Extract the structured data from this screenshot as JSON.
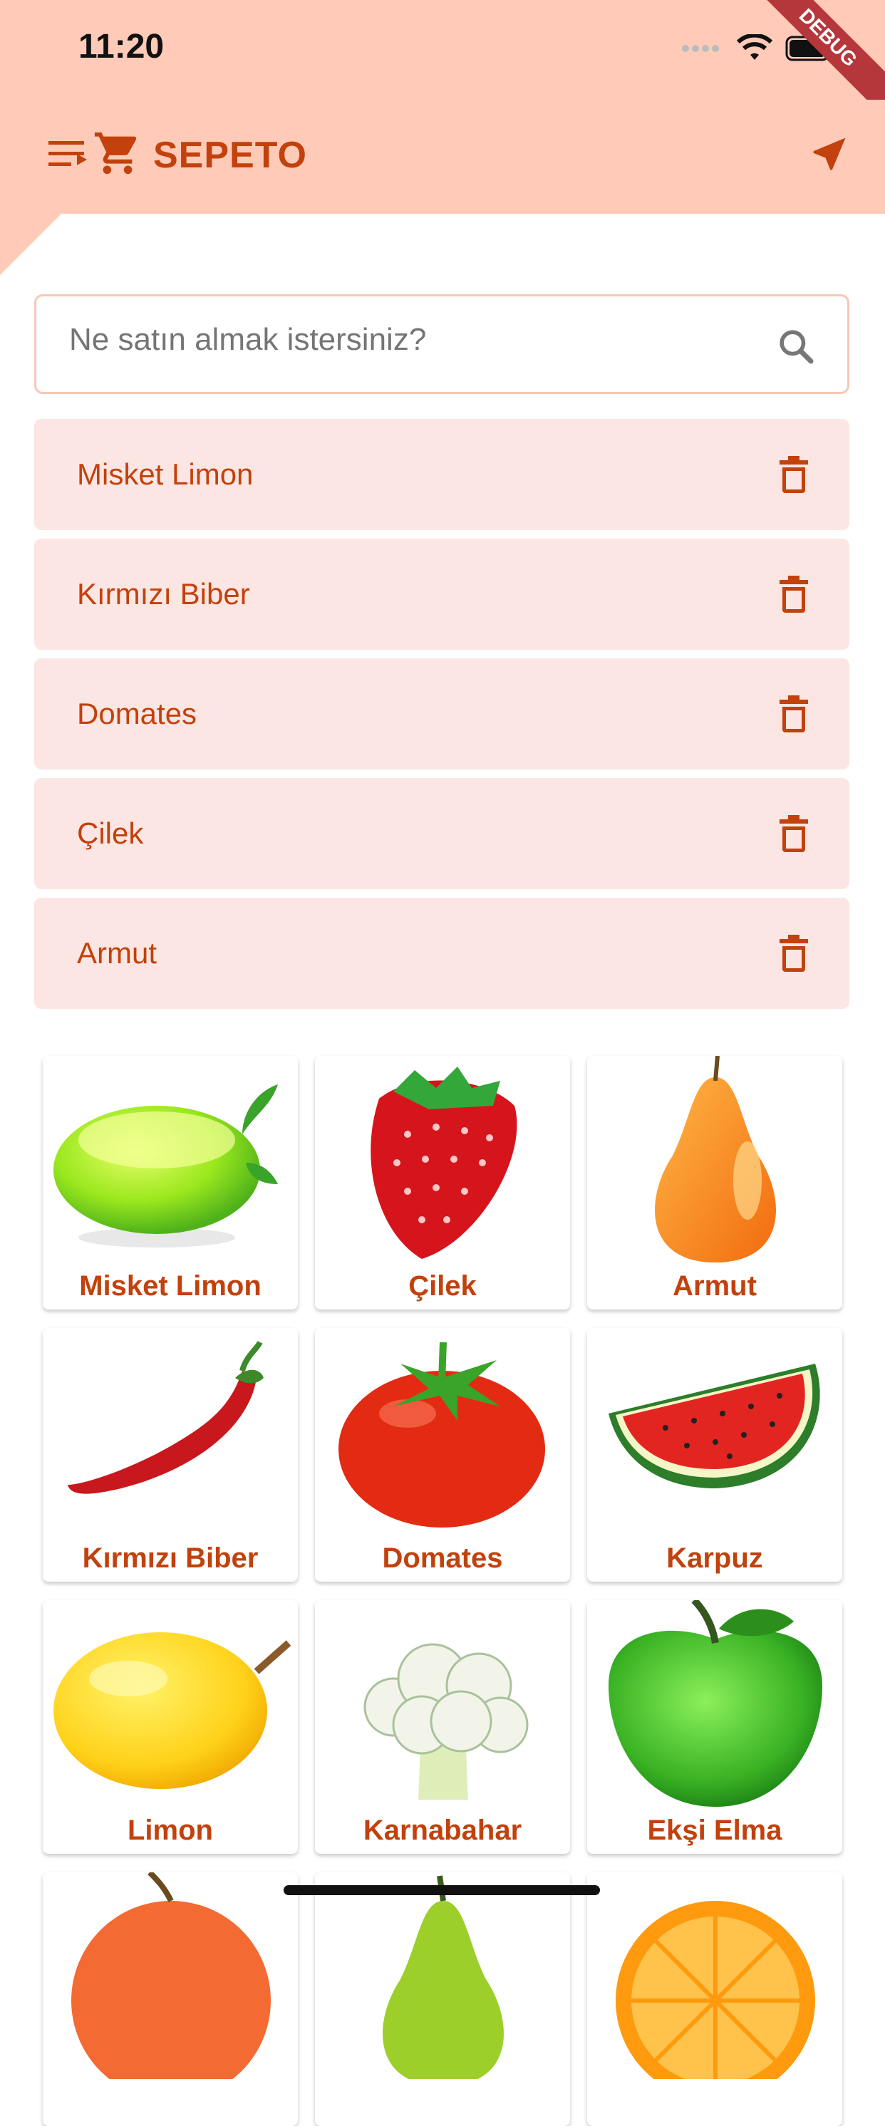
{
  "status": {
    "time": "11:20"
  },
  "app": {
    "title": "SEPETO"
  },
  "debug": "DEBUG",
  "search": {
    "placeholder": "Ne satın almak istersiniz?"
  },
  "basket": [
    {
      "label": "Misket Limon"
    },
    {
      "label": "Kırmızı Biber"
    },
    {
      "label": "Domates"
    },
    {
      "label": "Çilek"
    },
    {
      "label": "Armut"
    }
  ],
  "products": [
    {
      "label": "Misket Limon",
      "icon": "lime-image"
    },
    {
      "label": "Çilek",
      "icon": "strawberry-image"
    },
    {
      "label": "Armut",
      "icon": "pear-image"
    },
    {
      "label": "Kırmızı Biber",
      "icon": "red-pepper-image"
    },
    {
      "label": "Domates",
      "icon": "tomato-image"
    },
    {
      "label": "Karpuz",
      "icon": "watermelon-image"
    },
    {
      "label": "Limon",
      "icon": "lemon-image"
    },
    {
      "label": "Karnabahar",
      "icon": "cauliflower-image"
    },
    {
      "label": "Ekşi Elma",
      "icon": "green-apple-image"
    },
    {
      "label": "",
      "icon": "peach-image"
    },
    {
      "label": "",
      "icon": "pear-green-image"
    },
    {
      "label": "",
      "icon": "orange-image"
    }
  ],
  "colors": {
    "accent": "#c2410c",
    "appbar": "#ffcbb8",
    "item_bg": "#fce6e3"
  }
}
